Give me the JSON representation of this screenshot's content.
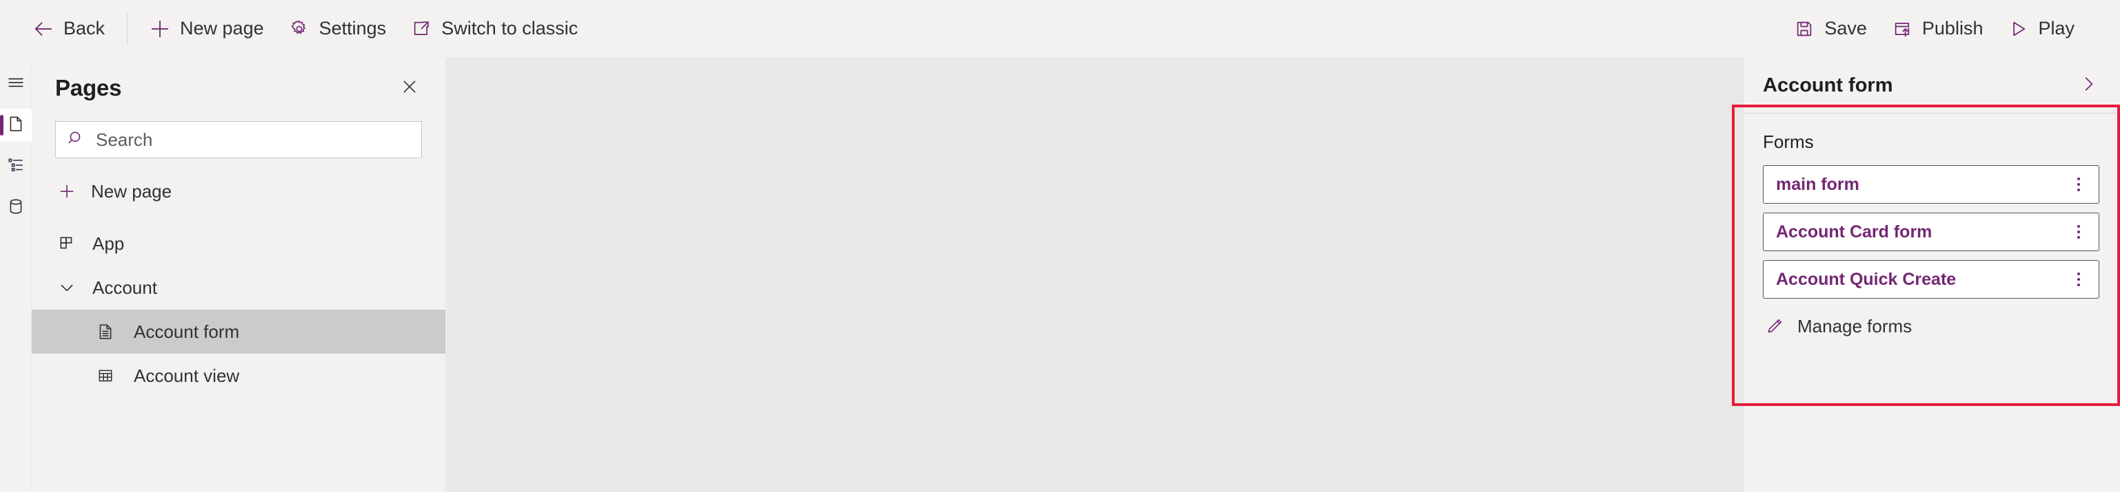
{
  "toolbar": {
    "left_items": [
      {
        "id": "back",
        "label": "Back",
        "icon": "arrow-left-icon"
      },
      {
        "id": "new-page",
        "label": "New page",
        "icon": "plus-icon"
      },
      {
        "id": "settings",
        "label": "Settings",
        "icon": "gear-icon"
      },
      {
        "id": "switch-to-classic",
        "label": "Switch to classic",
        "icon": "open-in-new-icon"
      }
    ],
    "right_items": [
      {
        "id": "save",
        "label": "Save",
        "icon": "save-icon"
      },
      {
        "id": "publish",
        "label": "Publish",
        "icon": "publish-icon"
      },
      {
        "id": "play",
        "label": "Play",
        "icon": "play-icon"
      }
    ]
  },
  "rail": {
    "items": [
      {
        "id": "menu",
        "icon": "hamburger-menu-icon",
        "selected": false
      },
      {
        "id": "pages",
        "icon": "page-icon",
        "selected": true
      },
      {
        "id": "navigation",
        "icon": "tree-list-icon",
        "selected": false
      },
      {
        "id": "data",
        "icon": "database-icon",
        "selected": false
      }
    ]
  },
  "pages_panel": {
    "title": "Pages",
    "close_icon": "close-icon",
    "search": {
      "placeholder": "Search",
      "value": "",
      "icon": "search-icon"
    },
    "new_page": {
      "label": "New page",
      "icon": "plus-icon"
    },
    "tree": [
      {
        "label": "App",
        "icon": "app-grid-icon",
        "level": 0,
        "selected": false,
        "expandable": false
      },
      {
        "label": "Account",
        "icon": "chevron-down-icon",
        "level": 1,
        "selected": false,
        "expandable": true,
        "expanded": true
      },
      {
        "label": "Account form",
        "icon": "form-document-icon",
        "level": 2,
        "selected": true,
        "expandable": false
      },
      {
        "label": "Account view",
        "icon": "table-grid-icon",
        "level": 2,
        "selected": false,
        "expandable": false
      }
    ]
  },
  "properties_panel": {
    "title": "Account form",
    "expand_icon": "chevron-right-icon",
    "forms_section": {
      "label": "Forms",
      "items": [
        {
          "name": "main form",
          "menu_icon": "more-vertical-icon"
        },
        {
          "name": "Account Card form",
          "menu_icon": "more-vertical-icon"
        },
        {
          "name": "Account Quick Create",
          "menu_icon": "more-vertical-icon"
        }
      ],
      "manage_link": {
        "label": "Manage forms",
        "icon": "pencil-icon"
      }
    }
  },
  "colors": {
    "accent_purple": "#742774",
    "annotation_red": "#e81b3c",
    "chrome_background": "#f3f2f1",
    "canvas_background": "#e9e8e6",
    "selected_row": "#cdcbc9"
  }
}
